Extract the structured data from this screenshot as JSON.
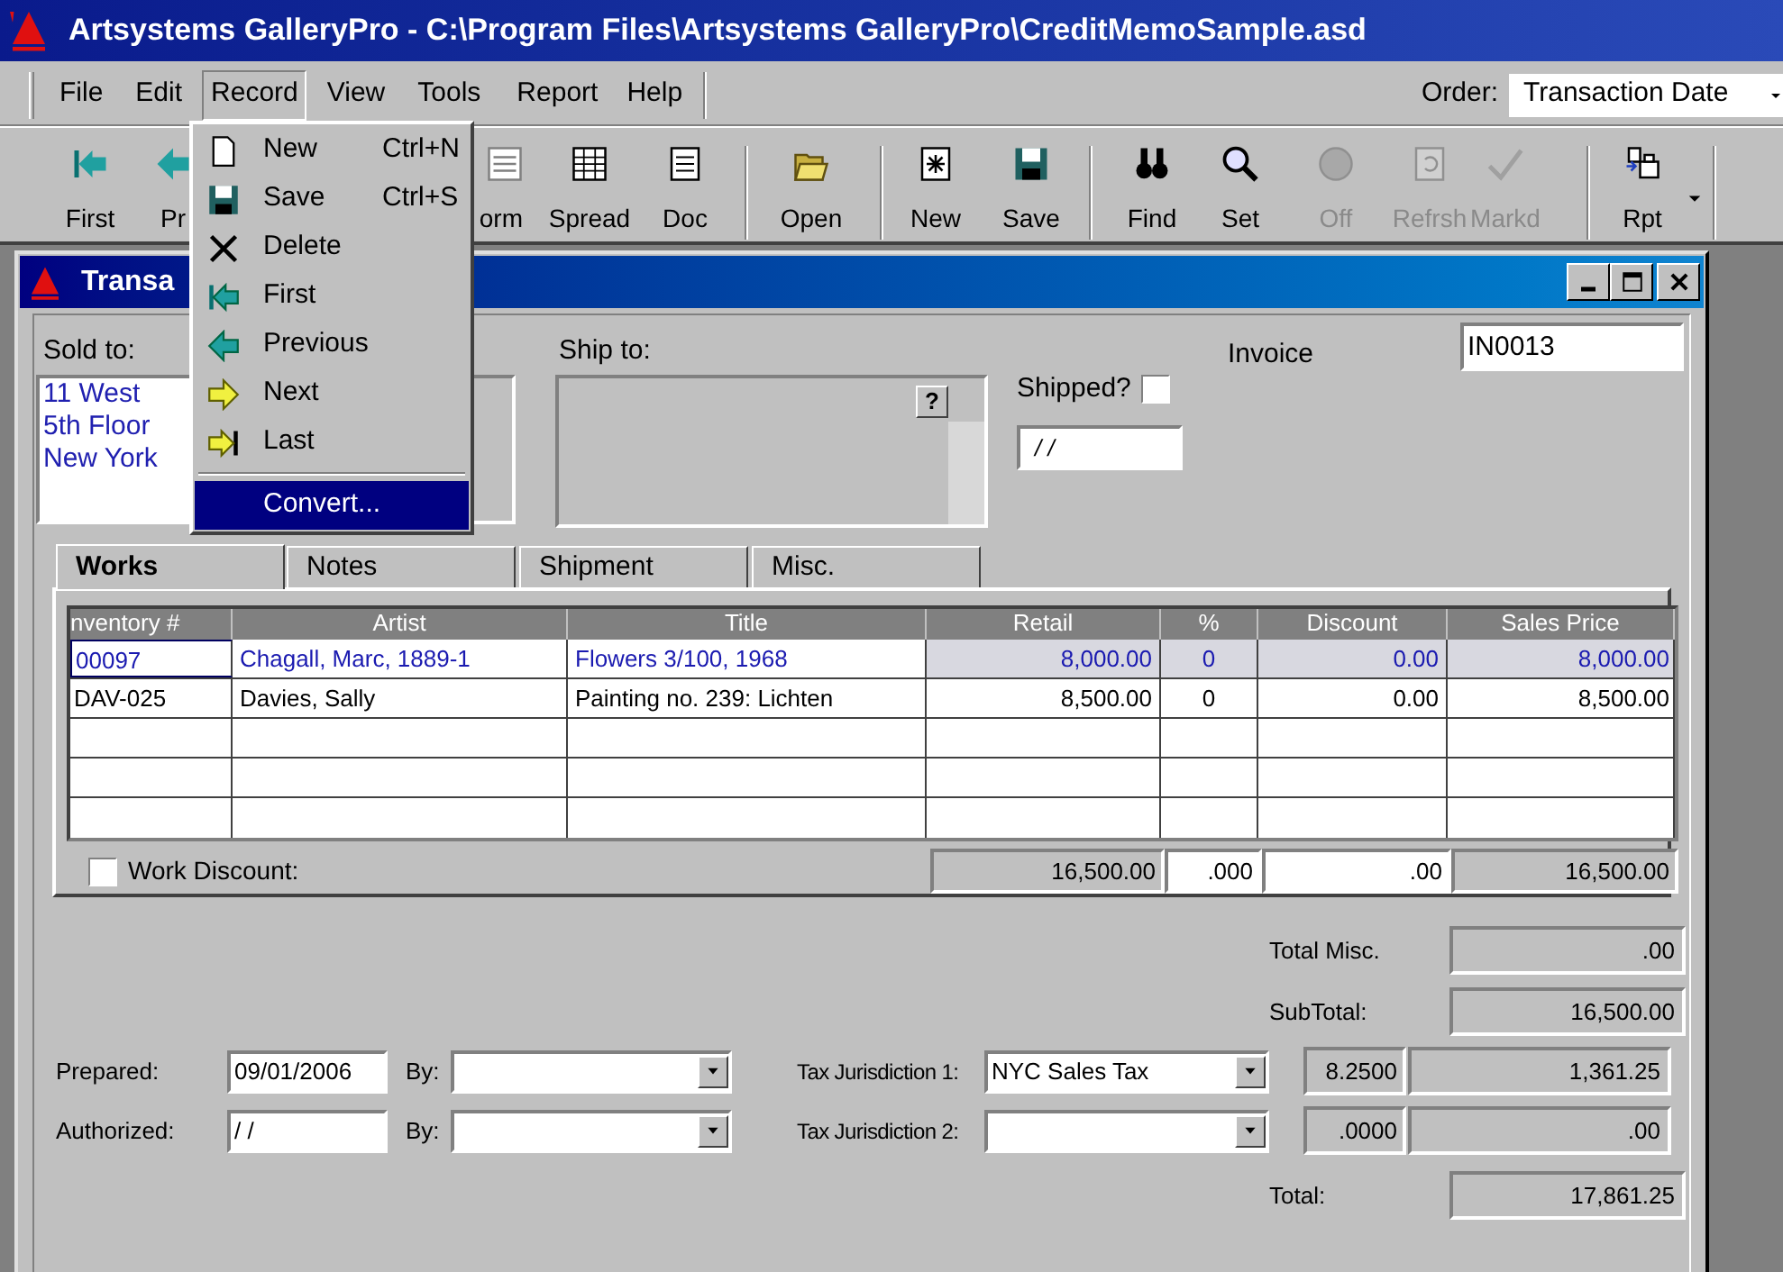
{
  "window": {
    "title": "Artsystems GalleryPro - C:\\Program Files\\Artsystems GalleryPro\\CreditMemoSample.asd"
  },
  "menu_bar": [
    {
      "label": "File",
      "selected": false
    },
    {
      "label": "Edit",
      "selected": false
    },
    {
      "label": "Record",
      "selected": true
    },
    {
      "label": "View",
      "selected": false
    },
    {
      "label": "Tools",
      "selected": false
    },
    {
      "label": "Report",
      "selected": false
    },
    {
      "label": "Help",
      "selected": false
    }
  ],
  "order": {
    "label": "Order:",
    "value": "Transaction Date"
  },
  "toolbar": [
    {
      "label": "First",
      "disabled": false
    },
    {
      "label": "Pr",
      "disabled": false
    },
    {
      "label": "orm",
      "disabled": false
    },
    {
      "label": "Spread",
      "disabled": false
    },
    {
      "label": "Doc",
      "disabled": false
    },
    {
      "label": "Open",
      "disabled": false
    },
    {
      "label": "New",
      "disabled": false
    },
    {
      "label": "Save",
      "disabled": false
    },
    {
      "label": "Find",
      "disabled": false
    },
    {
      "label": "Set",
      "disabled": false
    },
    {
      "label": "Off",
      "disabled": true
    },
    {
      "label": "Refrsh",
      "disabled": true
    },
    {
      "label": "Markd",
      "disabled": true
    },
    {
      "label": "Rpt",
      "disabled": false
    }
  ],
  "record_menu": [
    {
      "label": "New",
      "shortcut": "Ctrl+N",
      "selected": false,
      "separator_before": false
    },
    {
      "label": "Save",
      "shortcut": "Ctrl+S",
      "selected": false,
      "separator_before": false
    },
    {
      "label": "Delete",
      "selected": false,
      "separator_before": false
    },
    {
      "label": "First",
      "selected": false,
      "separator_before": false
    },
    {
      "label": "Previous",
      "selected": false,
      "separator_before": false
    },
    {
      "label": "Next",
      "selected": false,
      "separator_before": false
    },
    {
      "label": "Last",
      "selected": false,
      "separator_before": false
    },
    {
      "label": "Convert...",
      "selected": true,
      "separator_before": true
    }
  ],
  "child_window": {
    "title": "Transa"
  },
  "form": {
    "sold_to": {
      "label": "Sold to:",
      "lines": [
        "11 West",
        "5th Floor",
        "New York"
      ]
    },
    "ship_to": {
      "label": "Ship to:",
      "help": "?"
    },
    "shipped": {
      "label": "Shipped?",
      "checked": false,
      "date": "/ /"
    },
    "invoice": {
      "label": "Invoice",
      "value": "IN0013"
    }
  },
  "tabs": [
    {
      "label": "Works",
      "selected": true
    },
    {
      "label": "Notes",
      "selected": false
    },
    {
      "label": "Shipment",
      "selected": false
    },
    {
      "label": "Misc.",
      "selected": false
    }
  ],
  "works_table": {
    "columns": [
      "nventory #",
      "Artist",
      "Title",
      "Retail",
      "%",
      "Discount",
      "Sales Price"
    ],
    "rows": [
      {
        "selected": true,
        "cells": [
          "00097",
          "Chagall, Marc, 1889-1",
          "Flowers 3/100, 1968",
          "8,000.00",
          "0",
          "0.00",
          "8,000.00"
        ]
      },
      {
        "selected": false,
        "cells": [
          "DAV-025",
          "Davies, Sally",
          "Painting no. 239: Lichten",
          "8,500.00",
          "0",
          "0.00",
          "8,500.00"
        ]
      }
    ]
  },
  "work_discount": {
    "label": "Work Discount:",
    "checked": false,
    "retail": "16,500.00",
    "percent": ".000",
    "discount": ".00",
    "sales_price": "16,500.00"
  },
  "totals": {
    "total_misc": {
      "label": "Total Misc.",
      "value": ".00"
    },
    "subtotal": {
      "label": "SubTotal:",
      "value": "16,500.00"
    },
    "tax_1": {
      "label": "Tax Jurisdiction 1:",
      "jurisdiction": "NYC Sales Tax",
      "rate": "8.2500",
      "amount": "1,361.25"
    },
    "tax_2": {
      "label": "Tax Jurisdiction 2:",
      "rate": ".0000",
      "amount": ".00"
    },
    "total": {
      "label": "Total:",
      "value": "17,861.25"
    }
  },
  "prepared": {
    "label": "Prepared:",
    "date": "09/01/2006",
    "by_label": "By:"
  },
  "authorized": {
    "label": "Authorized:",
    "date": "/ /",
    "by_label": "By:"
  }
}
